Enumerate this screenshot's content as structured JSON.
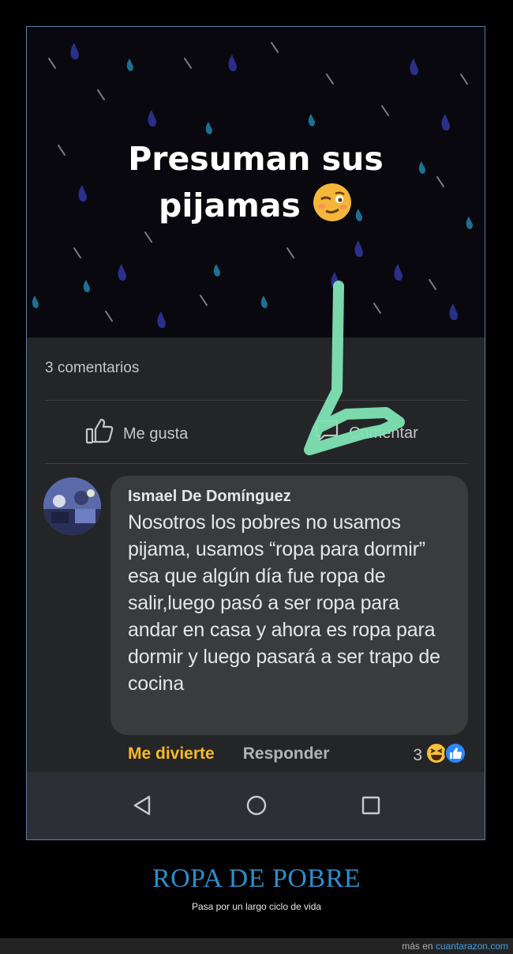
{
  "post": {
    "image_text_line1": "Presuman sus",
    "image_text_line2": "pijamas",
    "emoji": "woozy-face"
  },
  "feedback": {
    "comments_count": "3 comentarios",
    "like_label": "Me gusta",
    "comment_label": "Comentar"
  },
  "comment": {
    "author": "Ismael De Domínguez",
    "text": "Nosotros los pobres no usamos pijama, usamos “ropa para dormir” esa que algún día fue ropa de salir,luego pasó a ser ropa para andar en casa y ahora es ropa para dormir y luego pasará a ser trapo de cocina",
    "react_label": "Me divierte",
    "reply_label": "Responder",
    "reaction_count": "3",
    "reaction_icons": [
      "haha-icon",
      "like-icon"
    ]
  },
  "navbar": {
    "buttons": [
      "back-icon",
      "home-icon",
      "recents-icon"
    ]
  },
  "caption": {
    "title": "ROPA DE POBRE",
    "subtitle": "Pasa por un largo ciclo de vida"
  },
  "footer": {
    "prefix": "más en",
    "site": "cuantarazon.com"
  },
  "colors": {
    "annotation_arrow": "#7fe3b4",
    "react_label": "#f7b928",
    "caption_title": "#2d8ecb",
    "site_link": "#3ea0e0"
  }
}
